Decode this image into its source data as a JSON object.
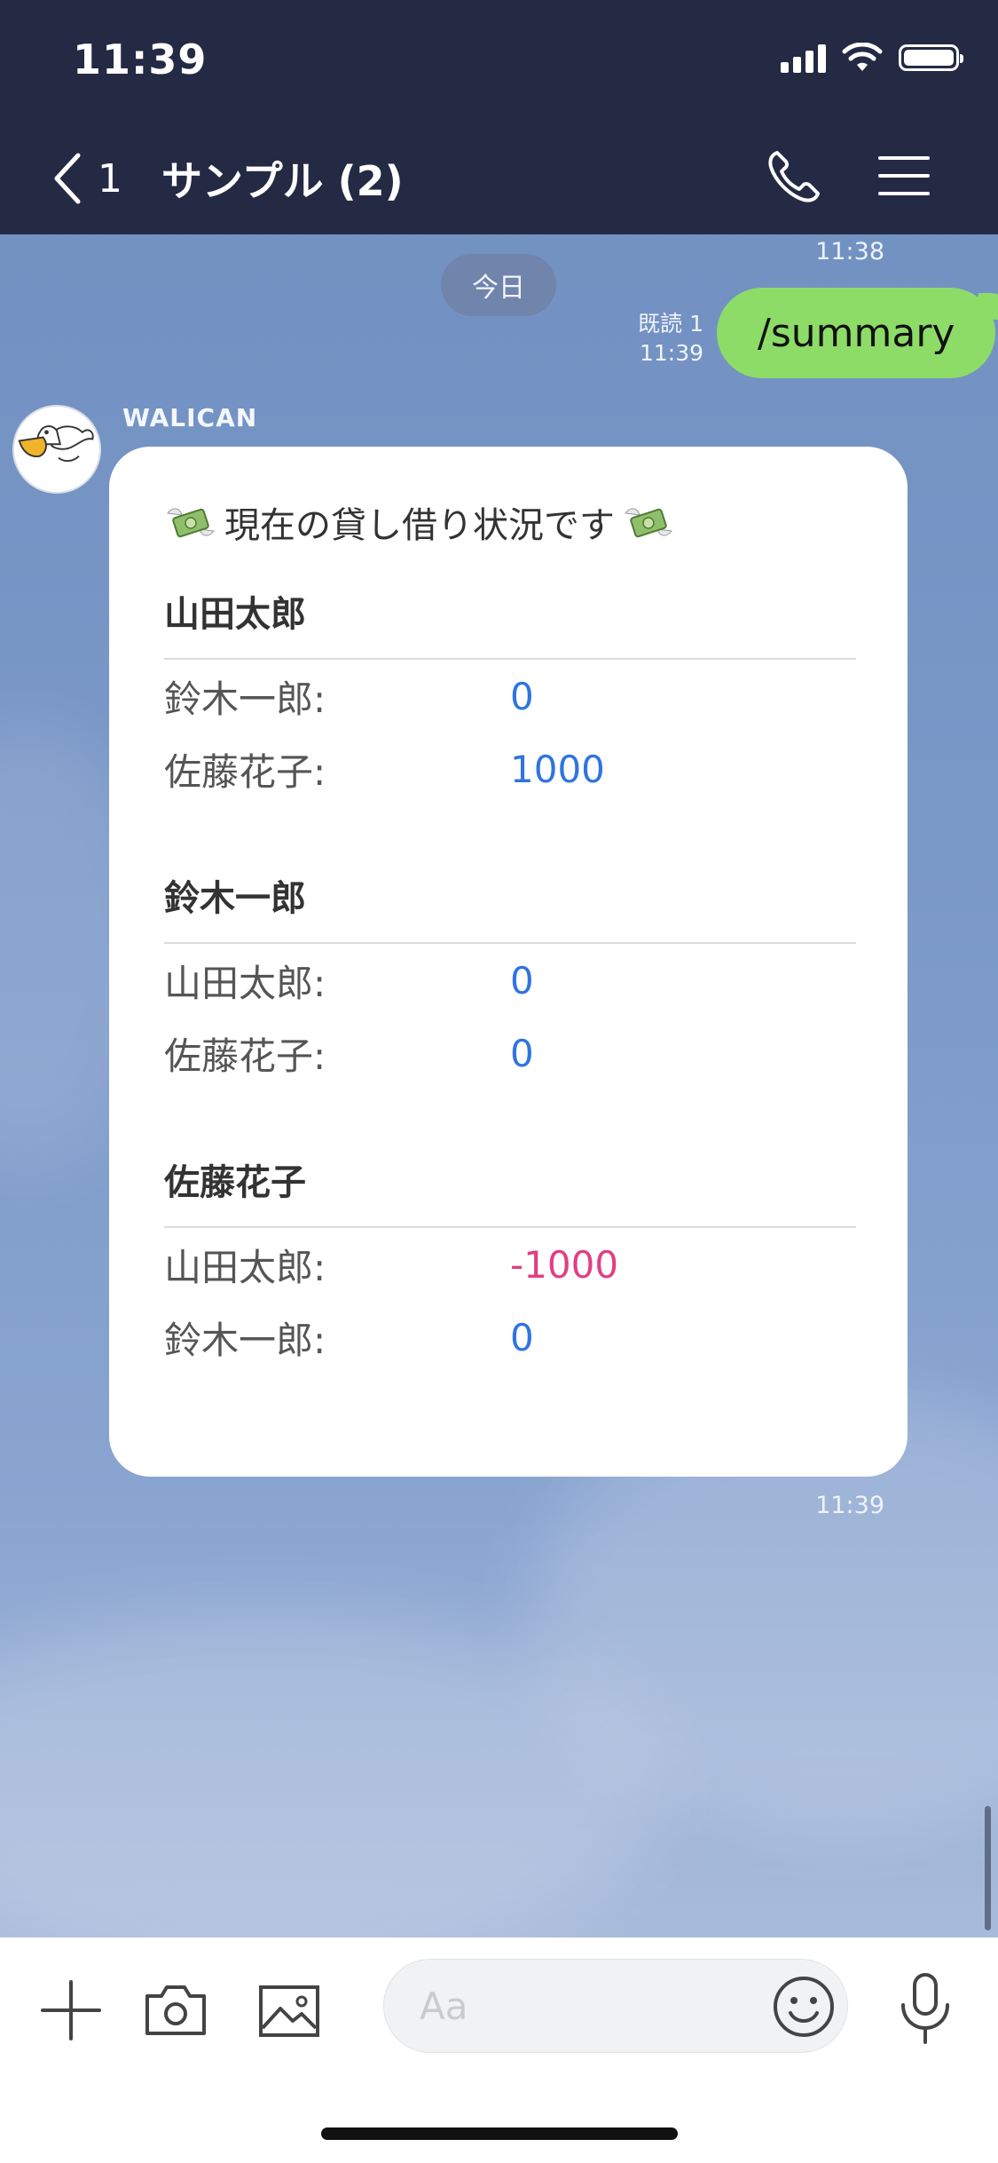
{
  "status_bar": {
    "time": "11:39"
  },
  "header": {
    "back_count": "1",
    "title": "サンプル (2)"
  },
  "chat": {
    "time_top": "11:38",
    "date_label": "今日",
    "outgoing": {
      "read_label": "既読 1",
      "time": "11:39",
      "text": "/summary"
    },
    "incoming": {
      "sender": "WALICAN",
      "card": {
        "header": "現在の貸し借り状況です",
        "sections": [
          {
            "name": "山田太郎",
            "rows": [
              {
                "who": "鈴木一郎:",
                "amount": "0"
              },
              {
                "who": "佐藤花子:",
                "amount": "1000"
              }
            ]
          },
          {
            "name": "鈴木一郎",
            "rows": [
              {
                "who": "山田太郎:",
                "amount": "0"
              },
              {
                "who": "佐藤花子:",
                "amount": "0"
              }
            ]
          },
          {
            "name": "佐藤花子",
            "rows": [
              {
                "who": "山田太郎:",
                "amount": "-1000"
              },
              {
                "who": "鈴木一郎:",
                "amount": "0"
              }
            ]
          }
        ]
      },
      "time": "11:39"
    }
  },
  "input_bar": {
    "placeholder": "Aa"
  },
  "colors": {
    "header_bg": "#242a44",
    "outgoing_bubble": "#8ddc67",
    "positive_amount": "#2f74e0",
    "negative_amount": "#e23e82"
  },
  "icons": [
    "signal-icon",
    "wifi-icon",
    "battery-icon",
    "back-chevron-icon",
    "phone-icon",
    "menu-icon",
    "plus-icon",
    "camera-icon",
    "image-icon",
    "emoji-icon",
    "mic-icon",
    "money-with-wings-icon"
  ]
}
